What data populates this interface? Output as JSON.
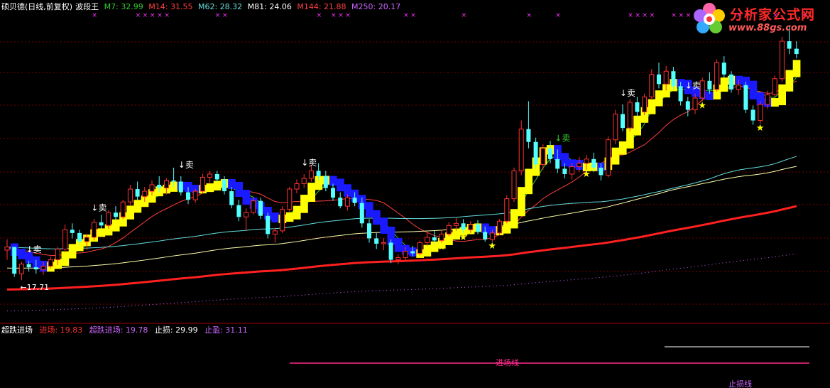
{
  "header": {
    "title": "硕贝德(日线,前复权)",
    "indicator": "波段王",
    "ma": [
      {
        "label": "M7: 32.99",
        "color": "#33cc33"
      },
      {
        "label": "M14: 31.55",
        "color": "#ff4040"
      },
      {
        "label": "M62: 28.32",
        "color": "#66dddd"
      },
      {
        "label": "M81: 24.06",
        "color": "#ffffff"
      },
      {
        "label": "M144: 21.88",
        "color": "#ff4040"
      },
      {
        "label": "M250: 20.17",
        "color": "#cc66ff"
      }
    ]
  },
  "sub_panel": {
    "name": "超跌进场",
    "fields": [
      {
        "label": "进场: 19.83",
        "color": "#ff3030"
      },
      {
        "label": "超跌进场: 19.78",
        "color": "#cc66ff"
      },
      {
        "label": "止损: 29.99",
        "color": "#ffffff"
      },
      {
        "label": "止盈: 31.11",
        "color": "#cc66ff"
      }
    ],
    "line_label_entry": "进场线",
    "line_label_profit": "止损线"
  },
  "logo": {
    "name": "分析家公式网",
    "url_text": "www.88gs.com"
  },
  "chart_data": {
    "type": "candlestick",
    "title": "硕贝德(日线,前复权) 波段王",
    "ylim": [
      14,
      40
    ],
    "low_annotation": "←17.71",
    "sell_label": "↓卖",
    "candles": [
      [
        20.5,
        21.5,
        19.6,
        20.8
      ],
      [
        20.8,
        20.8,
        18.0,
        18.3
      ],
      [
        18.3,
        19.4,
        17.7,
        19.2
      ],
      [
        19.2,
        19.5,
        18.5,
        18.9
      ],
      [
        18.9,
        19.6,
        18.3,
        18.7
      ],
      [
        18.7,
        19.4,
        18.2,
        19.0
      ],
      [
        19.0,
        19.9,
        18.8,
        19.6
      ],
      [
        19.6,
        20.8,
        19.1,
        20.6
      ],
      [
        20.6,
        22.9,
        20.3,
        22.4
      ],
      [
        22.4,
        23.0,
        21.6,
        22.1
      ],
      [
        22.1,
        22.4,
        21.0,
        21.3
      ],
      [
        21.3,
        22.0,
        20.5,
        21.7
      ],
      [
        21.7,
        23.4,
        21.4,
        23.1
      ],
      [
        23.1,
        23.8,
        22.5,
        22.8
      ],
      [
        22.8,
        24.2,
        22.5,
        24.0
      ],
      [
        24.0,
        24.6,
        23.3,
        23.6
      ],
      [
        23.6,
        25.2,
        23.4,
        25.0
      ],
      [
        25.0,
        26.6,
        24.7,
        26.2
      ],
      [
        26.2,
        26.9,
        25.2,
        25.5
      ],
      [
        25.5,
        26.4,
        25.0,
        26.0
      ],
      [
        26.0,
        27.0,
        25.6,
        26.6
      ],
      [
        26.6,
        27.4,
        25.9,
        26.3
      ],
      [
        26.3,
        27.2,
        25.7,
        27.0
      ],
      [
        27.0,
        28.2,
        26.4,
        26.9
      ],
      [
        26.9,
        27.4,
        25.6,
        25.9
      ],
      [
        25.9,
        26.4,
        24.8,
        25.2
      ],
      [
        25.2,
        26.2,
        24.9,
        26.0
      ],
      [
        26.0,
        27.6,
        25.8,
        27.3
      ],
      [
        27.3,
        27.9,
        26.7,
        27.6
      ],
      [
        27.6,
        27.9,
        26.9,
        27.1
      ],
      [
        27.1,
        27.4,
        25.7,
        26.0
      ],
      [
        26.0,
        26.4,
        24.4,
        24.7
      ],
      [
        24.7,
        25.2,
        23.2,
        23.6
      ],
      [
        23.6,
        24.4,
        22.3,
        24.0
      ],
      [
        24.0,
        25.4,
        23.8,
        25.1
      ],
      [
        25.1,
        25.4,
        23.4,
        23.7
      ],
      [
        23.7,
        24.0,
        21.6,
        22.0
      ],
      [
        22.0,
        22.6,
        21.2,
        22.3
      ],
      [
        22.3,
        24.6,
        22.1,
        24.3
      ],
      [
        24.3,
        26.4,
        24.1,
        26.2
      ],
      [
        26.2,
        27.1,
        25.8,
        26.7
      ],
      [
        26.7,
        27.6,
        26.3,
        27.2
      ],
      [
        27.2,
        28.4,
        26.9,
        27.9
      ],
      [
        27.9,
        28.6,
        27.0,
        27.4
      ],
      [
        27.4,
        27.9,
        26.0,
        26.3
      ],
      [
        26.3,
        26.7,
        25.1,
        25.4
      ],
      [
        25.4,
        25.9,
        24.4,
        24.6
      ],
      [
        24.6,
        25.7,
        24.2,
        25.4
      ],
      [
        25.4,
        25.9,
        24.6,
        24.9
      ],
      [
        24.9,
        25.4,
        22.6,
        23.0
      ],
      [
        23.0,
        23.4,
        21.2,
        21.6
      ],
      [
        21.6,
        22.1,
        20.6,
        21.1
      ],
      [
        21.1,
        21.6,
        20.5,
        21.2
      ],
      [
        21.2,
        21.5,
        19.3,
        19.6
      ],
      [
        19.6,
        20.1,
        19.2,
        19.8
      ],
      [
        19.8,
        20.8,
        19.5,
        20.4
      ],
      [
        20.4,
        20.9,
        19.9,
        20.2
      ],
      [
        20.2,
        21.4,
        20.0,
        21.2
      ],
      [
        21.2,
        22.1,
        20.9,
        21.7
      ],
      [
        21.7,
        22.3,
        21.1,
        21.4
      ],
      [
        21.4,
        22.4,
        21.2,
        22.0
      ],
      [
        22.0,
        23.1,
        21.8,
        22.8
      ],
      [
        22.8,
        23.5,
        22.3,
        23.0
      ],
      [
        23.0,
        23.4,
        22.1,
        22.4
      ],
      [
        22.4,
        23.2,
        22.1,
        22.9
      ],
      [
        22.9,
        23.3,
        22.0,
        22.2
      ],
      [
        22.2,
        22.7,
        21.3,
        21.5
      ],
      [
        21.5,
        22.4,
        21.3,
        22.1
      ],
      [
        22.1,
        23.4,
        21.9,
        23.2
      ],
      [
        23.2,
        25.6,
        23.0,
        25.3
      ],
      [
        25.3,
        28.2,
        25.0,
        27.9
      ],
      [
        27.9,
        32.6,
        27.5,
        31.8
      ],
      [
        31.8,
        34.4,
        30.0,
        30.6
      ],
      [
        30.6,
        31.0,
        28.1,
        28.5
      ],
      [
        28.5,
        30.4,
        28.0,
        30.0
      ],
      [
        30.0,
        30.7,
        28.6,
        29.0
      ],
      [
        29.0,
        29.9,
        27.7,
        28.1
      ],
      [
        28.1,
        28.6,
        27.2,
        27.6
      ],
      [
        27.6,
        28.6,
        27.1,
        28.3
      ],
      [
        28.3,
        29.2,
        27.8,
        28.6
      ],
      [
        28.6,
        29.4,
        28.0,
        29.0
      ],
      [
        29.0,
        29.6,
        27.8,
        28.2
      ],
      [
        28.2,
        28.6,
        27.0,
        27.5
      ],
      [
        27.5,
        31.1,
        27.3,
        30.8
      ],
      [
        30.8,
        33.6,
        30.4,
        33.2
      ],
      [
        33.2,
        34.1,
        31.6,
        31.9
      ],
      [
        31.9,
        34.6,
        31.6,
        34.3
      ],
      [
        34.3,
        34.8,
        33.0,
        33.4
      ],
      [
        33.4,
        35.1,
        33.1,
        34.8
      ],
      [
        34.8,
        37.4,
        34.5,
        36.9
      ],
      [
        36.9,
        38.0,
        35.6,
        36.0
      ],
      [
        36.0,
        37.7,
        35.4,
        37.2
      ],
      [
        37.2,
        37.6,
        35.5,
        35.8
      ],
      [
        35.8,
        36.2,
        34.0,
        34.4
      ],
      [
        34.4,
        34.8,
        33.0,
        33.6
      ],
      [
        33.6,
        35.1,
        33.2,
        34.7
      ],
      [
        34.7,
        36.6,
        34.4,
        36.3
      ],
      [
        36.3,
        37.1,
        35.1,
        35.5
      ],
      [
        35.5,
        38.3,
        35.3,
        38.0
      ],
      [
        38.0,
        38.6,
        36.6,
        36.9
      ],
      [
        36.9,
        37.2,
        35.2,
        35.5
      ],
      [
        35.5,
        36.4,
        35.0,
        35.9
      ],
      [
        35.9,
        36.2,
        33.3,
        33.6
      ],
      [
        33.6,
        34.0,
        32.2,
        32.6
      ],
      [
        32.6,
        34.4,
        32.3,
        34.1
      ],
      [
        34.1,
        35.4,
        33.7,
        35.0
      ],
      [
        35.0,
        36.8,
        34.8,
        36.5
      ],
      [
        36.5,
        40.4,
        36.2,
        40.0
      ],
      [
        40.0,
        41.4,
        38.8,
        39.3
      ],
      [
        39.3,
        40.0,
        38.4,
        38.8
      ]
    ],
    "ma_series": [
      {
        "name": "M7",
        "color": "#33cc33"
      },
      {
        "name": "M14",
        "color": "#ff4040"
      },
      {
        "name": "M62",
        "color": "#66dddd"
      },
      {
        "name": "M81",
        "color": "#ffffaa"
      },
      {
        "name": "M144",
        "color": "#ff2020"
      },
      {
        "name": "M250",
        "color": "#cc66ff"
      }
    ],
    "sell_signal_index": [
      3,
      12,
      24,
      41,
      76,
      85,
      94
    ],
    "buy_star_index": [
      8,
      28,
      39,
      60,
      63,
      67,
      73,
      80,
      86,
      96,
      104
    ],
    "cross_marker_index": [
      12,
      18,
      19,
      20,
      21,
      22,
      29,
      30,
      43,
      45,
      46,
      47,
      55,
      56,
      63,
      72,
      76,
      86,
      87,
      88,
      89,
      92,
      93,
      94,
      96,
      101,
      102,
      106,
      110
    ]
  }
}
